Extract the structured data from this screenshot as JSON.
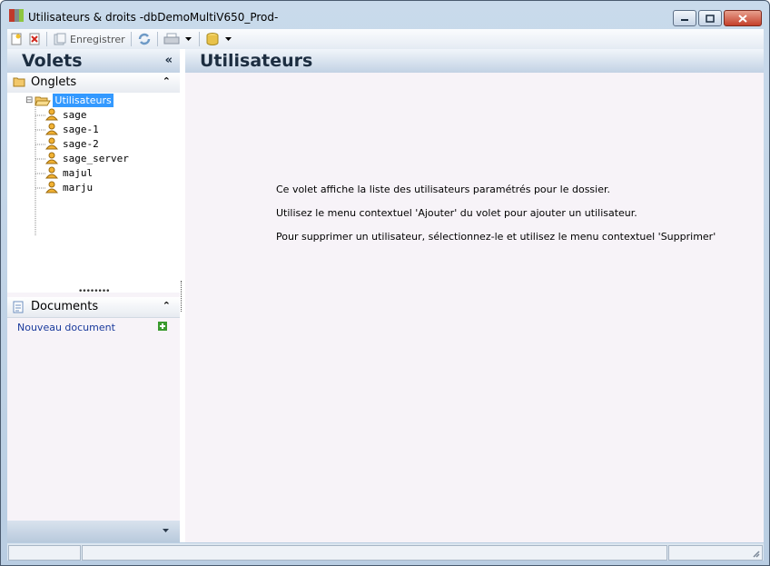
{
  "window": {
    "title": "Utilisateurs & droits -dbDemoMultiV650_Prod-"
  },
  "toolbar": {
    "save_label": "Enregistrer"
  },
  "left_pane": {
    "title": "Volets",
    "collapse_glyph": "«",
    "onglets": {
      "title": "Onglets",
      "toggle_glyph": "⌃",
      "tree": {
        "root": {
          "label": "Utilisateurs",
          "expander": "⊟"
        },
        "users": [
          "sage",
          "sage-1",
          "sage-2",
          "sage_server",
          "majul",
          "marju"
        ]
      }
    },
    "splitter": "••••••••",
    "documents": {
      "title": "Documents",
      "toggle_glyph": "⌃",
      "new_link": "Nouveau document"
    }
  },
  "main": {
    "title": "Utilisateurs",
    "messages": [
      "Ce volet affiche la liste des utilisateurs paramétrés pour le dossier.",
      "Utilisez le menu contextuel 'Ajouter' du volet pour ajouter un utilisateur.",
      "Pour supprimer un utilisateur, sélectionnez-le et utilisez le menu contextuel 'Supprimer'"
    ]
  },
  "icons": {
    "new": "new-document-icon",
    "delete": "delete-icon",
    "save": "save-icon",
    "refresh": "refresh-icon",
    "print": "printer-icon",
    "database": "database-icon",
    "user": "user-icon",
    "folder": "folder-icon"
  },
  "colors": {
    "selection": "#3399ff",
    "link": "#1a3a9c",
    "header_text": "#1c2d40",
    "pane_bg": "#f7f3f8"
  }
}
